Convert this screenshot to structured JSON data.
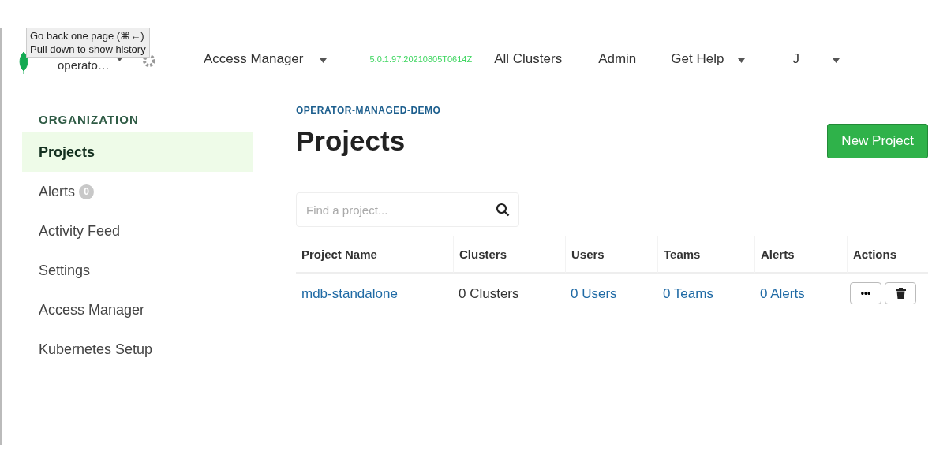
{
  "tooltip": {
    "lines": [
      "Go back one page (⌘←)",
      "Pull down to show history"
    ]
  },
  "nav": {
    "org": "operato…",
    "items": [
      {
        "label": "Access Manager",
        "dropdown": true
      }
    ],
    "version": "5.0.1.97.20210805T0614Z",
    "links": [
      {
        "label": "All Clusters",
        "dropdown": false
      },
      {
        "label": "Admin",
        "dropdown": false
      },
      {
        "label": "Get Help",
        "dropdown": true
      },
      {
        "label": "J",
        "dropdown": true
      }
    ]
  },
  "sidebar": {
    "heading": "ORGANIZATION",
    "items": [
      {
        "label": "Projects",
        "selected": true
      },
      {
        "label": "Alerts",
        "selected": false,
        "badge": "0"
      },
      {
        "label": "Activity Feed",
        "selected": false
      },
      {
        "label": "Settings",
        "selected": false
      },
      {
        "label": "Access Manager",
        "selected": false
      },
      {
        "label": "Kubernetes Setup",
        "selected": false
      }
    ]
  },
  "breadcrumb": "OPERATOR-MANAGED-DEMO",
  "title": "Projects",
  "new_button": "New Project",
  "search": {
    "placeholder": "Find a project..."
  },
  "table": {
    "columns": [
      "Project Name",
      "Clusters",
      "Users",
      "Teams",
      "Alerts",
      "Actions"
    ],
    "rows": [
      {
        "cells": [
          {
            "text": "mdb-standalone",
            "link": true
          },
          {
            "text": "0 Clusters",
            "link": false
          },
          {
            "text": "0 Users",
            "link": true
          },
          {
            "text": "0 Teams",
            "link": true
          },
          {
            "text": "0 Alerts",
            "link": true
          }
        ],
        "actions": [
          "•••"
        ]
      }
    ]
  }
}
